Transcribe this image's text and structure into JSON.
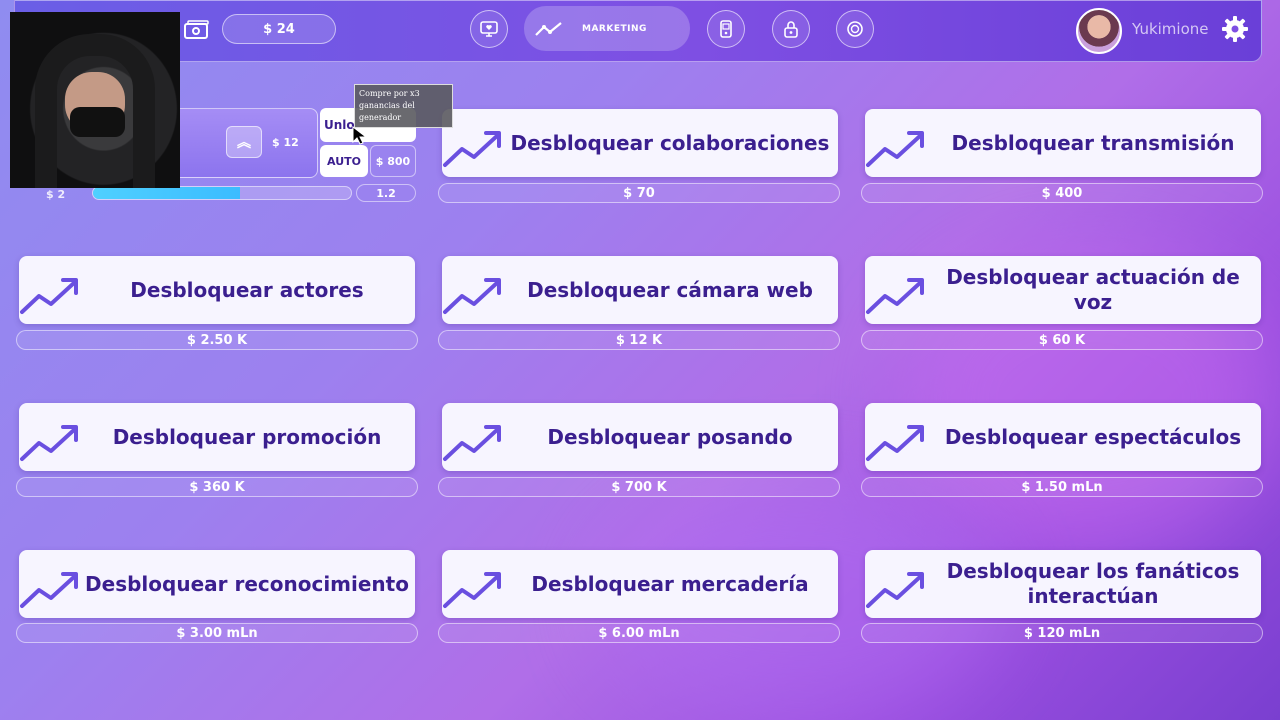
{
  "header": {
    "money": "$ 24",
    "active_tab": "MARKETING",
    "username": "Yukimione"
  },
  "generator": {
    "upgrade_price": "$ 12",
    "unlock_label": "Unlo",
    "auto_label": "AUTO",
    "auto_price": "$ 800",
    "earnings": "$ 2",
    "progress": 0.57,
    "multiplier": "1.2",
    "tooltip": "Compre por x3 ganancias del generador"
  },
  "cards": [
    {
      "label": "Desbloquear colaboraciones",
      "price": "$ 70"
    },
    {
      "label": "Desbloquear transmisión",
      "price": "$ 400"
    },
    {
      "label": "Desbloquear actores",
      "price": "$ 2.50 K"
    },
    {
      "label": "Desbloquear cámara web",
      "price": "$ 12 K"
    },
    {
      "label": "Desbloquear actuación de voz",
      "price": "$ 60 K"
    },
    {
      "label": "Desbloquear promoción",
      "price": "$ 360 K"
    },
    {
      "label": "Desbloquear posando",
      "price": "$ 700 K"
    },
    {
      "label": "Desbloquear espectáculos",
      "price": "$ 1.50 mLn"
    },
    {
      "label": "Desbloquear reconocimiento",
      "price": "$ 3.00 mLn"
    },
    {
      "label": "Desbloquear mercadería",
      "price": "$ 6.00 mLn"
    },
    {
      "label": "Desbloquear los fanáticos interactúan",
      "price": "$ 120 mLn"
    }
  ],
  "colors": {
    "card_text": "#3b1f8f",
    "accent": "#6a4fe0",
    "progress": "#3bbcff"
  }
}
